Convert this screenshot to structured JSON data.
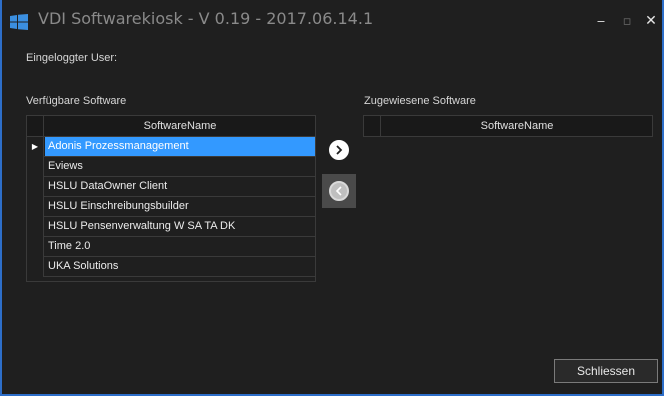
{
  "window": {
    "title": "VDI Softwarekiosk - V 0.19 - 2017.06.14.1",
    "minimize_symbol": "‒",
    "maximize_symbol": "▫",
    "close_symbol": "✕",
    "accent_color": "#2d6ec9"
  },
  "user": {
    "label": "Eingeloggter User:"
  },
  "available": {
    "label": "Verfügbare Software",
    "column_header": "SoftwareName",
    "current_row_marker": "▶",
    "rows": [
      {
        "name": "Adonis Prozessmanagement",
        "selected": true
      },
      {
        "name": "Eviews",
        "selected": false
      },
      {
        "name": "HSLU DataOwner Client",
        "selected": false
      },
      {
        "name": "HSLU Einschreibungsbuilder",
        "selected": false
      },
      {
        "name": "HSLU Pensenverwaltung W SA TA DK",
        "selected": false
      },
      {
        "name": "Time 2.0",
        "selected": false
      },
      {
        "name": "UKA Solutions",
        "selected": false
      }
    ],
    "selection_color": "#3399ff"
  },
  "assigned": {
    "label": "Zugewiesene Software",
    "column_header": "SoftwareName",
    "rows": []
  },
  "actions": {
    "move_right_icon": "arrow-right-circle-icon",
    "move_left_icon": "arrow-left-circle-icon",
    "close_label": "Schliessen"
  }
}
